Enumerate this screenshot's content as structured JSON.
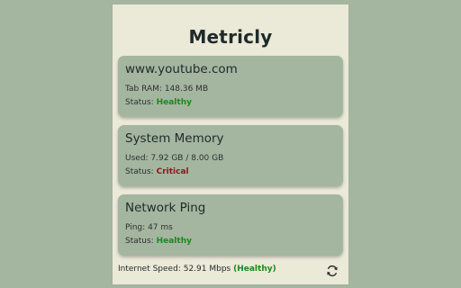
{
  "app": {
    "title": "Metricly"
  },
  "cards": [
    {
      "title": "www.youtube.com",
      "metric_label": "Tab RAM:",
      "metric_value": "148.36 MB",
      "status_label": "Status:",
      "status_value": "Healthy"
    },
    {
      "title": "System Memory",
      "metric_label": "Used:",
      "metric_value": "7.92 GB / 8.00 GB",
      "status_label": "Status:",
      "status_value": "Critical"
    },
    {
      "title": "Network Ping",
      "metric_label": "Ping:",
      "metric_value": "47 ms",
      "status_label": "Status:",
      "status_value": "Healthy"
    }
  ],
  "footer": {
    "label": "Internet Speed:",
    "value": "52.91 Mbps",
    "status": "(Healthy)",
    "refresh_icon": "refresh-icon"
  },
  "colors": {
    "background": "#a4b5a0",
    "panel": "#ebe9d8",
    "healthy": "#1a8a1a",
    "critical": "#8e1616"
  }
}
